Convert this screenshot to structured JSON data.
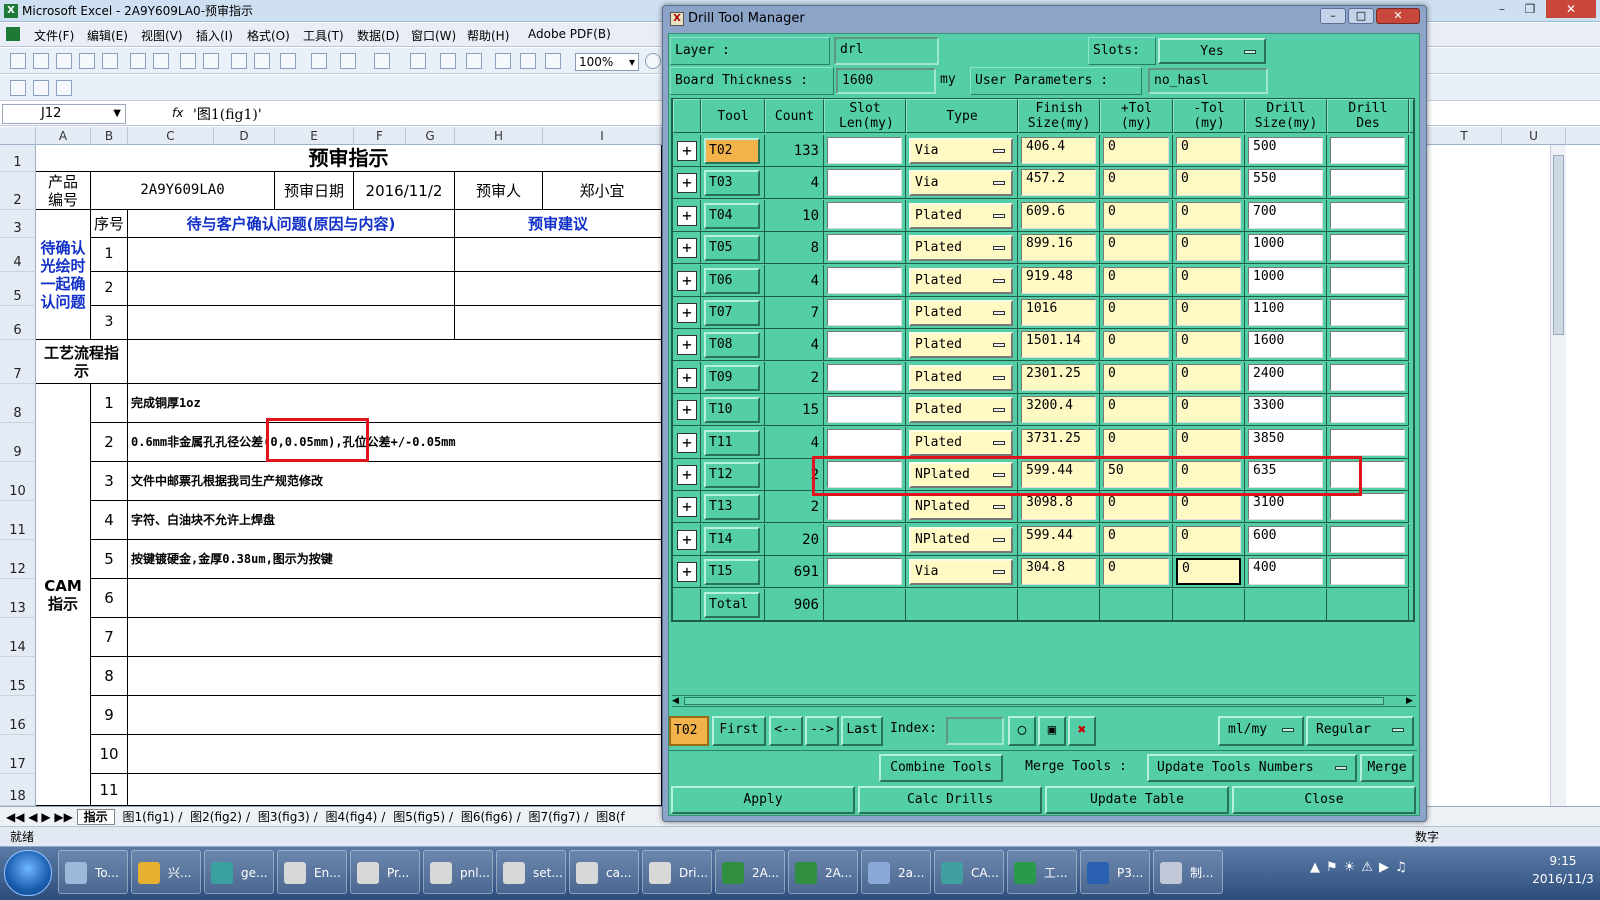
{
  "excel": {
    "title": "Microsoft Excel - 2A9Y609LA0-预审指示",
    "menu": [
      "文件(F)",
      "编辑(E)",
      "视图(V)",
      "插入(I)",
      "格式(O)",
      "工具(T)",
      "数据(D)",
      "窗口(W)",
      "帮助(H)",
      "Adobe PDF(B)"
    ],
    "zoom": "100%",
    "name_box": "J12",
    "fx": "fx",
    "formula": "'图1(fig1)'",
    "columns": [
      "A",
      "B",
      "C",
      "D",
      "E",
      "F",
      "G",
      "H",
      "I"
    ],
    "right_columns": [
      "T",
      "U"
    ],
    "rows": [
      "1",
      "2",
      "3",
      "4",
      "5",
      "6",
      "7",
      "8",
      "9",
      "10",
      "11",
      "12",
      "13",
      "14",
      "15",
      "16",
      "17",
      "18"
    ],
    "sheet": {
      "title": "预审指示",
      "product_label": "产品编号",
      "product_no": "2A9Y609LA0",
      "date_label": "预审日期",
      "date": "2016/11/2",
      "reviewer_label": "预审人",
      "reviewer": "郑小宜",
      "seq_label": "序号",
      "issues_header": "待与客户确认问题(原因与内容)",
      "suggest_header": "预审建议",
      "pending_label": "待确认光绘时一起确认问题",
      "pending_rows": [
        "1",
        "2",
        "3"
      ],
      "process_label": "工艺流程指示",
      "cam_label": "CAM指示",
      "cam_items": [
        {
          "no": "1",
          "text": "完成铜厚1oz"
        },
        {
          "no": "2",
          "text": "0.6mm非金属孔孔径公差(0,0.05mm),孔位公差+/-0.05mm"
        },
        {
          "no": "3",
          "text": "文件中邮票孔根据我司生产规范修改"
        },
        {
          "no": "4",
          "text": "字符、白油块不允许上焊盘"
        },
        {
          "no": "5",
          "text": "按键镀硬金,金厚0.38um,图示为按键"
        },
        {
          "no": "6",
          "text": ""
        },
        {
          "no": "7",
          "text": ""
        },
        {
          "no": "8",
          "text": ""
        },
        {
          "no": "9",
          "text": ""
        },
        {
          "no": "10",
          "text": ""
        },
        {
          "no": "11",
          "text": ""
        }
      ]
    },
    "tabs": [
      "指示",
      "图1(fig1)",
      "图2(fig2)",
      "图3(fig3)",
      "图4(fig4)",
      "图5(fig5)",
      "图6(fig6)",
      "图7(fig7)",
      "图8(f"
    ],
    "status_left": "就绪",
    "status_right": "数字"
  },
  "dialog": {
    "title": "Drill Tool Manager",
    "layer_label": "Layer             :",
    "layer_value": "drl",
    "slots_label": "Slots:",
    "slots_value": "Yes",
    "thickness_label": "Board Thickness  :",
    "thickness_value": "1600",
    "thickness_unit": "my",
    "userparam_label": "User Parameters  :",
    "userparam_value": "no_hasl",
    "headers": [
      "Tool",
      "Count",
      "Slot Len(my)",
      "Type",
      "Finish Size(my)",
      "+Tol (my)",
      "-Tol (my)",
      "Drill Size(my)",
      "Drill Des"
    ],
    "rows": [
      {
        "tool": "T02",
        "count": "133",
        "type": "Via",
        "finish": "406.4",
        "ptol": "0",
        "ntol": "0",
        "drill": "500"
      },
      {
        "tool": "T03",
        "count": "4",
        "type": "Via",
        "finish": "457.2",
        "ptol": "0",
        "ntol": "0",
        "drill": "550"
      },
      {
        "tool": "T04",
        "count": "10",
        "type": "Plated",
        "finish": "609.6",
        "ptol": "0",
        "ntol": "0",
        "drill": "700"
      },
      {
        "tool": "T05",
        "count": "8",
        "type": "Plated",
        "finish": "899.16",
        "ptol": "0",
        "ntol": "0",
        "drill": "1000"
      },
      {
        "tool": "T06",
        "count": "4",
        "type": "Plated",
        "finish": "919.48",
        "ptol": "0",
        "ntol": "0",
        "drill": "1000"
      },
      {
        "tool": "T07",
        "count": "7",
        "type": "Plated",
        "finish": "1016",
        "ptol": "0",
        "ntol": "0",
        "drill": "1100"
      },
      {
        "tool": "T08",
        "count": "4",
        "type": "Plated",
        "finish": "1501.14",
        "ptol": "0",
        "ntol": "0",
        "drill": "1600"
      },
      {
        "tool": "T09",
        "count": "2",
        "type": "Plated",
        "finish": "2301.25",
        "ptol": "0",
        "ntol": "0",
        "drill": "2400"
      },
      {
        "tool": "T10",
        "count": "15",
        "type": "Plated",
        "finish": "3200.4",
        "ptol": "0",
        "ntol": "0",
        "drill": "3300"
      },
      {
        "tool": "T11",
        "count": "4",
        "type": "Plated",
        "finish": "3731.25",
        "ptol": "0",
        "ntol": "0",
        "drill": "3850"
      },
      {
        "tool": "T12",
        "count": "2",
        "type": "NPlated",
        "finish": "599.44",
        "ptol": "50",
        "ntol": "0",
        "drill": "635"
      },
      {
        "tool": "T13",
        "count": "2",
        "type": "NPlated",
        "finish": "3098.8",
        "ptol": "0",
        "ntol": "0",
        "drill": "3100"
      },
      {
        "tool": "T14",
        "count": "20",
        "type": "NPlated",
        "finish": "599.44",
        "ptol": "0",
        "ntol": "0",
        "drill": "600"
      },
      {
        "tool": "T15",
        "count": "691",
        "type": "Via",
        "finish": "304.8",
        "ptol": "0",
        "ntol": "0",
        "drill": "400"
      }
    ],
    "total_label": "Total",
    "total_count": "906",
    "nav": {
      "current": "T02",
      "first": "First",
      "prev": "<--",
      "next": "-->",
      "last": "Last",
      "index_label": "Index:",
      "units": "ml/my",
      "mode": "Regular"
    },
    "actions1": {
      "combine": "Combine Tools",
      "merge_tools": "Merge Tools :",
      "update_numbers": "Update Tools Numbers",
      "merge": "Merge"
    },
    "actions2": {
      "apply": "Apply",
      "calc": "Calc Drills",
      "update": "Update Table",
      "close": "Close"
    }
  },
  "taskbar": {
    "items": [
      "To...",
      "兴...",
      "ge...",
      "En...",
      "Pr...",
      "pnl...",
      "set...",
      "ca...",
      "Dri...",
      "2A...",
      "2A...",
      "2a...",
      "CA...",
      "工...",
      "P3...",
      "制..."
    ],
    "time": "9:15",
    "date": "2016/11/3"
  },
  "colors": {
    "dialog_bg": "#53cea6",
    "highlight_red": "#e0141c",
    "tool_selected": "#f2b44a",
    "field_yellow": "#fff9c4"
  }
}
